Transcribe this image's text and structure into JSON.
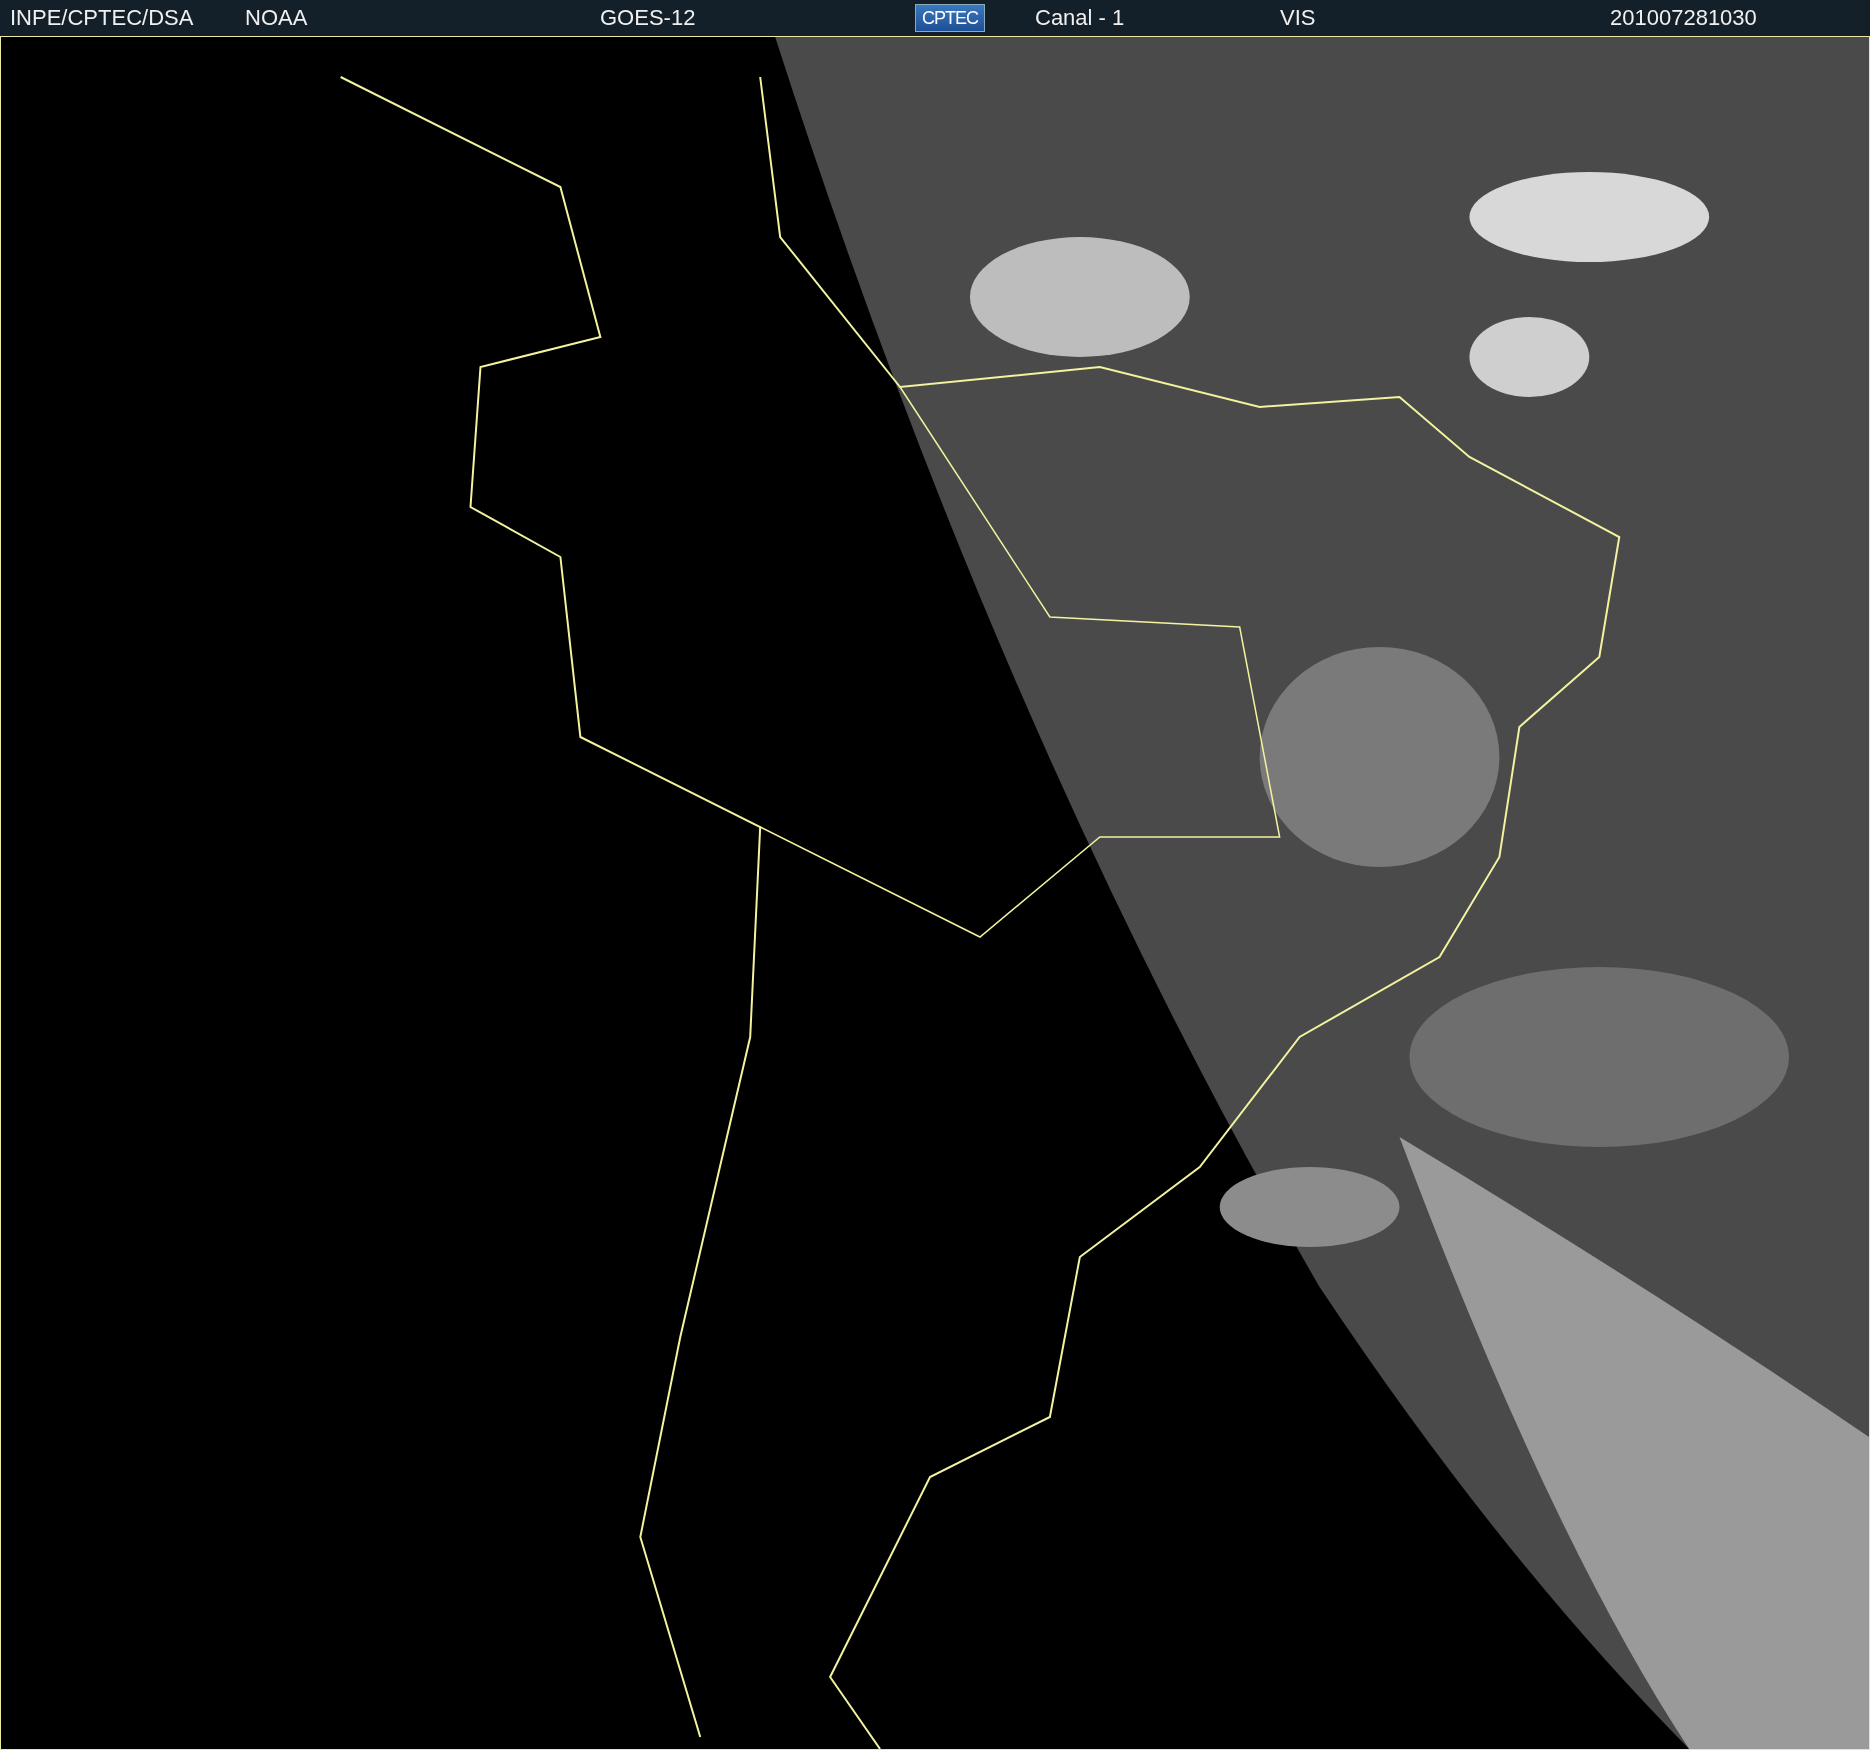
{
  "header": {
    "items": [
      {
        "kind": "text",
        "text": "INPE/CPTEC/DSA"
      },
      {
        "kind": "text",
        "text": "NOAA"
      },
      {
        "kind": "text",
        "text": "GOES-12"
      },
      {
        "kind": "logo",
        "text": "CPTEC"
      },
      {
        "kind": "text",
        "text": "Canal - 1"
      },
      {
        "kind": "text",
        "text": "VIS"
      },
      {
        "kind": "text",
        "text": "201007281030"
      }
    ]
  }
}
